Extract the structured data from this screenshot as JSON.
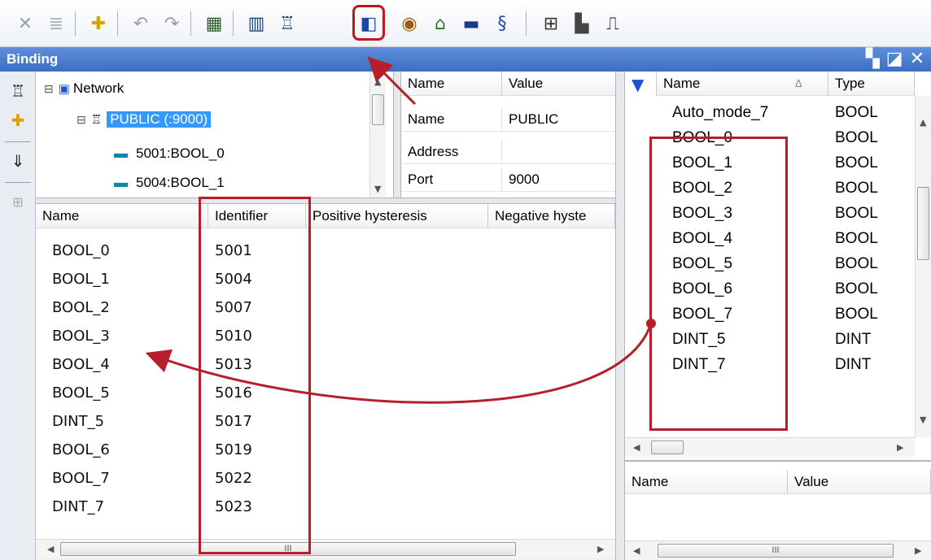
{
  "panel": {
    "title": "Binding"
  },
  "tree": {
    "root": "Network",
    "group": "PUBLIC (:9000)",
    "items": [
      "5001:BOOL_0",
      "5004:BOOL_1"
    ]
  },
  "properties": {
    "headers": [
      "Name",
      "Value"
    ],
    "rows": [
      {
        "name": "Name",
        "value": "PUBLIC"
      },
      {
        "name": "Address",
        "value": ""
      },
      {
        "name": "Port",
        "value": "9000"
      }
    ]
  },
  "binding_list": {
    "headers": [
      "Name",
      "Identifier",
      "Positive hysteresis",
      "Negative hyste"
    ],
    "rows": [
      {
        "name": "BOOL_0",
        "id": "5001"
      },
      {
        "name": "BOOL_1",
        "id": "5004"
      },
      {
        "name": "BOOL_2",
        "id": "5007"
      },
      {
        "name": "BOOL_3",
        "id": "5010"
      },
      {
        "name": "BOOL_4",
        "id": "5013"
      },
      {
        "name": "BOOL_5",
        "id": "5016"
      },
      {
        "name": "DINT_5",
        "id": "5017"
      },
      {
        "name": "BOOL_6",
        "id": "5019"
      },
      {
        "name": "BOOL_7",
        "id": "5022"
      },
      {
        "name": "DINT_7",
        "id": "5023"
      }
    ]
  },
  "variables": {
    "headers": [
      "Name",
      "Type"
    ],
    "sort_indicator": "Δ",
    "rows": [
      {
        "name": "Auto_mode_7",
        "type": "BOOL"
      },
      {
        "name": "BOOL_0",
        "type": "BOOL"
      },
      {
        "name": "BOOL_1",
        "type": "BOOL"
      },
      {
        "name": "BOOL_2",
        "type": "BOOL"
      },
      {
        "name": "BOOL_3",
        "type": "BOOL"
      },
      {
        "name": "BOOL_4",
        "type": "BOOL"
      },
      {
        "name": "BOOL_5",
        "type": "BOOL"
      },
      {
        "name": "BOOL_6",
        "type": "BOOL"
      },
      {
        "name": "BOOL_7",
        "type": "BOOL"
      },
      {
        "name": "DINT_5",
        "type": "DINT"
      },
      {
        "name": "DINT_7",
        "type": "DINT"
      }
    ]
  },
  "bottom_grid": {
    "headers": [
      "Name",
      "Value"
    ]
  },
  "scrollbar": {
    "grip": "III"
  },
  "colors": {
    "titlebar": "#3b6fc4",
    "selection": "#3399ff",
    "annotation": "#b51e2a"
  }
}
